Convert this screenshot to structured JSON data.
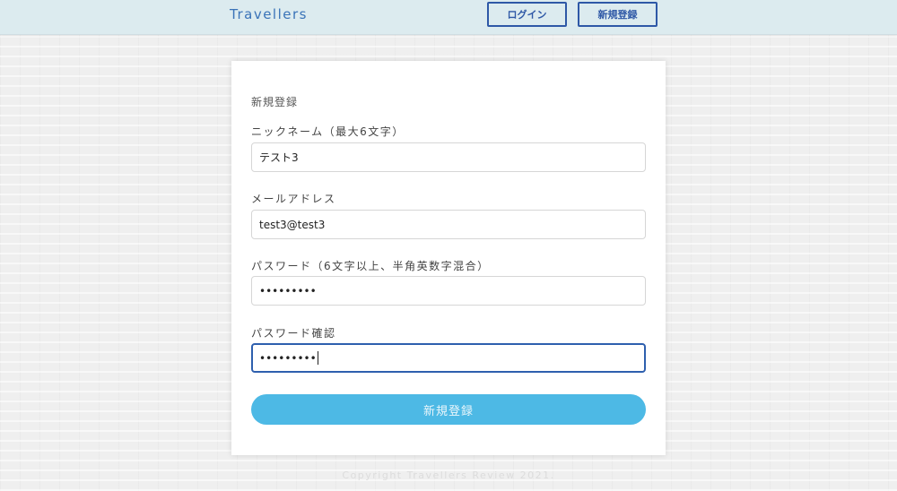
{
  "header": {
    "logo": "Travellers",
    "login_label": "ログイン",
    "signup_label": "新規登録"
  },
  "form": {
    "title": "新規登録",
    "nickname": {
      "label": "ニックネーム（最大6文字）",
      "value": "テスト3"
    },
    "email": {
      "label": "メールアドレス",
      "value": "test3@test3"
    },
    "password": {
      "label": "パスワード（6文字以上、半角英数字混合）",
      "value": "•••••••••"
    },
    "password_confirm": {
      "label": "パスワード確認",
      "value": "•••••••••"
    },
    "submit_label": "新規登録"
  },
  "footer": {
    "copyright": "Copyright Travellers Review 2021."
  },
  "colors": {
    "header_bg": "#dcebef",
    "accent": "#2e58a6",
    "submit_bg": "#4db9e5"
  }
}
